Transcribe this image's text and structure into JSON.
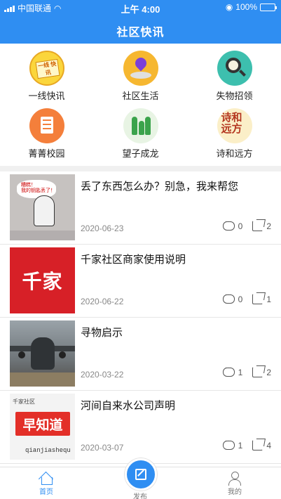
{
  "status_bar": {
    "carrier": "中国联通",
    "time": "上午 4:00",
    "battery": "100%"
  },
  "header": {
    "title": "社区快讯"
  },
  "categories": [
    {
      "label": "一线快讯",
      "icon": "news-flash-icon",
      "icon_text": "一线\n快讯"
    },
    {
      "label": "社区生活",
      "icon": "map-pin-icon"
    },
    {
      "label": "失物招领",
      "icon": "magnifier-icon"
    },
    {
      "label": "菁菁校园",
      "icon": "document-icon"
    },
    {
      "label": "望子成龙",
      "icon": "family-icon"
    },
    {
      "label": "诗和远方",
      "icon": "poetry-icon",
      "icon_text": "诗和\n远方"
    }
  ],
  "news": [
    {
      "title": "丢了东西怎么办？别急，我来帮您",
      "date": "2020-06-23",
      "comments": "0",
      "shares": "2",
      "thumb_text": "糟糕！\n我的钥匙丢了！"
    },
    {
      "title": "千家社区商家使用说明",
      "date": "2020-06-22",
      "comments": "0",
      "shares": "1",
      "thumb_text": "千家"
    },
    {
      "title": "寻物启示",
      "date": "2020-03-22",
      "comments": "1",
      "shares": "2"
    },
    {
      "title": "河间自来水公司声明",
      "date": "2020-03-07",
      "comments": "1",
      "shares": "4",
      "thumb_small": "千家社区",
      "thumb_text": "早知道",
      "thumb_url": "qianjiashequ"
    }
  ],
  "tabbar": {
    "home": "首页",
    "publish": "发布",
    "mine": "我的"
  },
  "colors": {
    "primary": "#2f8ef2",
    "divider": "#e6e6e6"
  }
}
